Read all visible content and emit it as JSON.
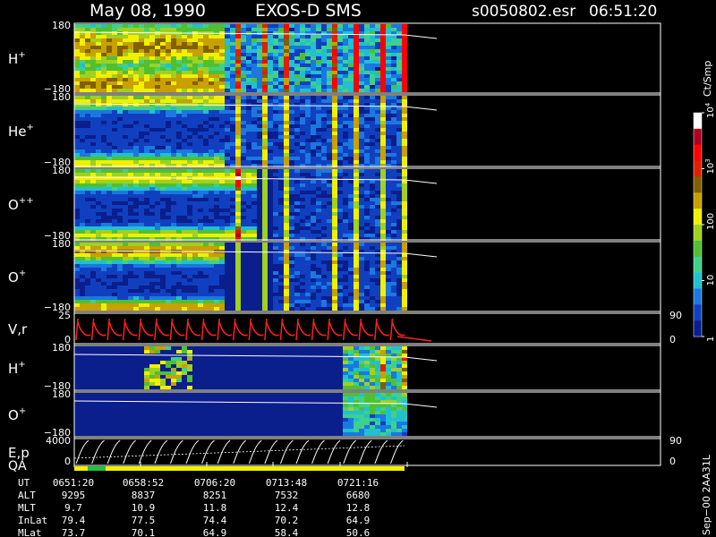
{
  "header": {
    "date": "May 08, 1990",
    "instrument": "EXOS-D SMS",
    "file": "s0050802.esr",
    "time": "06:51:20"
  },
  "colorbar": {
    "unit": "Ct/Smp",
    "tick_labels": [
      "10",
      "10",
      "100",
      "10",
      "1"
    ],
    "tick_exponents": [
      "4",
      "3",
      "",
      "",
      ""
    ],
    "tick_values": [
      10000,
      1000,
      100,
      10,
      1
    ]
  },
  "chart_data": {
    "type": "heatmap",
    "x_time_labels": [
      "0651:20",
      "0658:52",
      "0706:20",
      "0713:48",
      "0721:16"
    ],
    "panels": [
      {
        "label": "H",
        "sup": "+",
        "y_top": "180",
        "y_bottom": "−180"
      },
      {
        "label": "He",
        "sup": "+",
        "y_top": "180",
        "y_bottom": "−180"
      },
      {
        "label": "O",
        "sup": "++",
        "y_top": "180",
        "y_bottom": "−180"
      },
      {
        "label": "O",
        "sup": "+",
        "y_top": "180",
        "y_bottom": "−180"
      },
      {
        "label": "V,r",
        "sup": "",
        "y_top": "25",
        "y_bottom": "0",
        "right_top": "90",
        "right_bottom": "0"
      },
      {
        "label": "H",
        "sup": "+",
        "y_top": "180",
        "y_bottom": "−180"
      },
      {
        "label": "O",
        "sup": "+",
        "y_top": "180",
        "y_bottom": "−180"
      },
      {
        "label": "E,p",
        "sup": "",
        "y_top": "4000",
        "y_bottom": "0",
        "right_top": "90",
        "right_bottom": "0"
      }
    ],
    "qa_label": "QA",
    "orbit_table": {
      "rows": [
        {
          "name": "UT",
          "values": [
            "0651:20",
            "0658:52",
            "0706:20",
            "0713:48",
            "0721:16"
          ]
        },
        {
          "name": "ALT",
          "values": [
            "9295",
            "8837",
            "8251",
            "7532",
            "6680"
          ]
        },
        {
          "name": "MLT",
          "values": [
            "9.7",
            "10.9",
            "11.8",
            "12.4",
            "12.8"
          ]
        },
        {
          "name": "InLat",
          "values": [
            "79.4",
            "77.5",
            "74.4",
            "70.2",
            "64.9"
          ]
        },
        {
          "name": "MLat",
          "values": [
            "73.7",
            "70.1",
            "64.9",
            "58.4",
            "50.6"
          ]
        }
      ]
    }
  },
  "footer": {
    "version_note": "Sep−00 2AA31L"
  }
}
